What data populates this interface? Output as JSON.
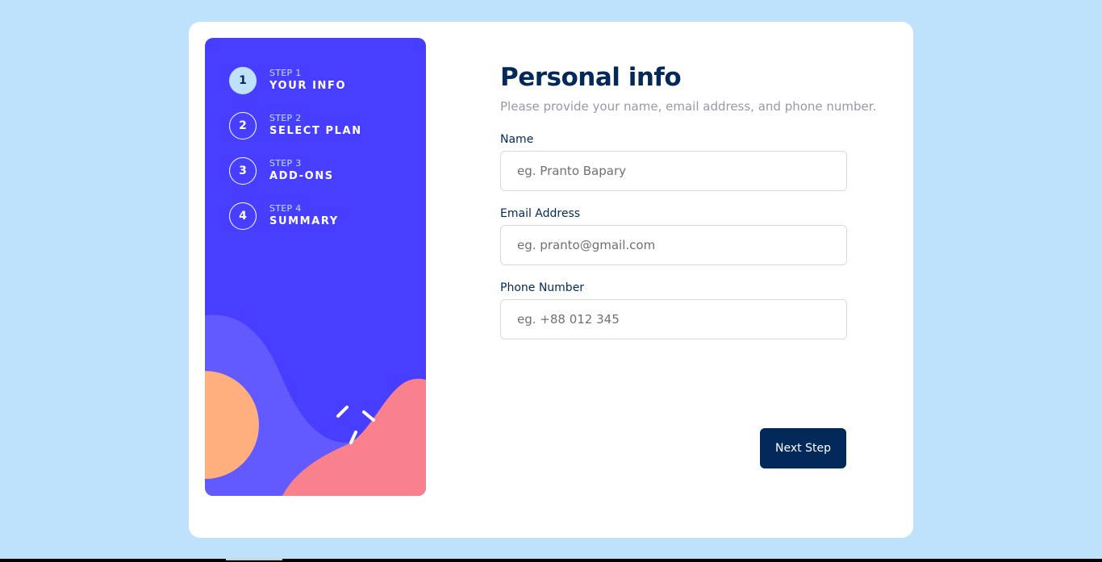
{
  "colors": {
    "page_bg": "#bee2fc",
    "sidebar_bg": "#483eff",
    "accent_dark": "#022959",
    "muted_text": "#9699aa",
    "blob_orange": "#ffaf7e",
    "blob_pink": "#f9818e",
    "blob_violet": "#6259ff"
  },
  "steps": [
    {
      "number": "1",
      "label": "STEP 1",
      "title": "YOUR INFO",
      "active": true
    },
    {
      "number": "2",
      "label": "STEP 2",
      "title": "SELECT PLAN",
      "active": false
    },
    {
      "number": "3",
      "label": "STEP 3",
      "title": "ADD-ONS",
      "active": false
    },
    {
      "number": "4",
      "label": "STEP 4",
      "title": "SUMMARY",
      "active": false
    }
  ],
  "form": {
    "title": "Personal info",
    "subtitle": "Please provide your name, email address, and phone number.",
    "fields": {
      "name": {
        "label": "Name",
        "value": "",
        "placeholder": "eg. Pranto Bapary"
      },
      "email": {
        "label": "Email Address",
        "value": "",
        "placeholder": "eg. pranto@gmail.com"
      },
      "phone": {
        "label": "Phone Number",
        "value": "",
        "placeholder": "eg. +88 012 345"
      }
    },
    "next_label": "Next Step"
  }
}
